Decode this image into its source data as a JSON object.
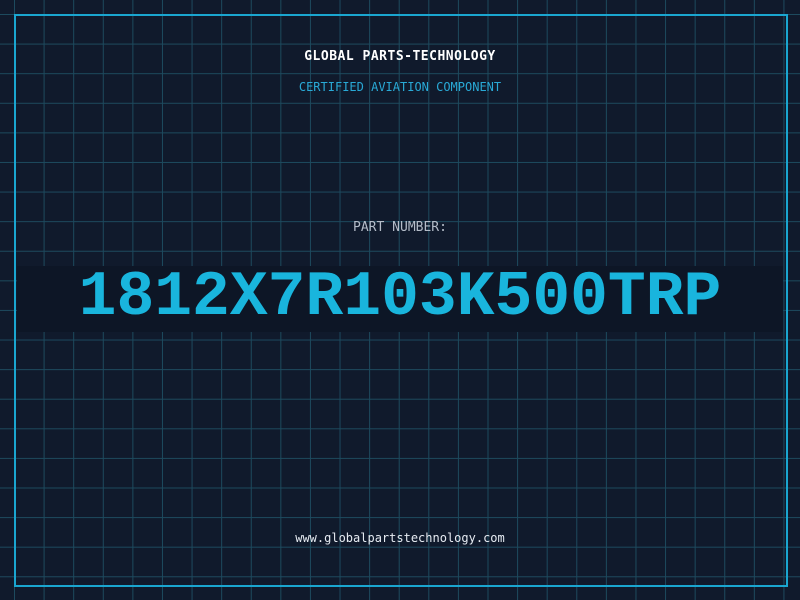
{
  "header": {
    "brand": "GLOBAL PARTS-TECHNOLOGY",
    "subtitle": "CERTIFIED AVIATION COMPONENT"
  },
  "part": {
    "label": "PART NUMBER:",
    "number": "1812X7R103K500TRP"
  },
  "footer": {
    "website": "www.globalpartstechnology.com"
  },
  "colors": {
    "background": "#101a2c",
    "grid": "#1d4a5e",
    "accent": "#1aa6d0",
    "part_number": "#19b5dd"
  }
}
